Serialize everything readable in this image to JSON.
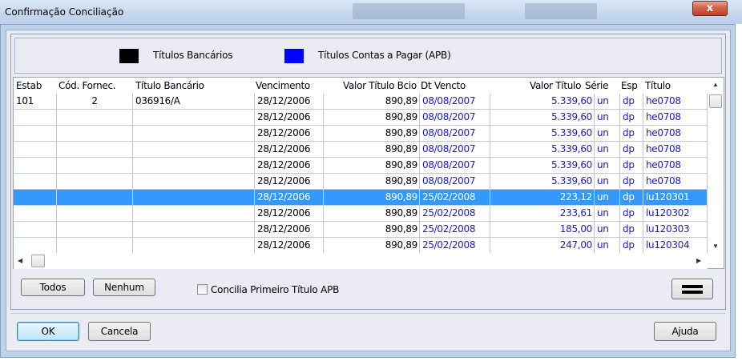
{
  "window": {
    "title": "Confirmação Conciliação",
    "close_glyph": "x"
  },
  "legend": {
    "bank_label": "Títulos Bancários",
    "bank_color": "#000000",
    "apb_label": "Títulos Contas a Pagar (APB)",
    "apb_color": "#0000ff"
  },
  "grid": {
    "columns": [
      "Estab",
      "Cód. Fornec.",
      "Título Bancário",
      "Vencimento",
      "Valor Título Bcio",
      "Dt Vencto",
      "Valor Título",
      "Série",
      "Esp",
      "Título"
    ],
    "rows": [
      {
        "estab": "101",
        "fornec": "2",
        "titulo_bancario": "036916/A",
        "vencimento": "28/12/2006",
        "valor_bcio": "890,89",
        "dt_vencto": "08/08/2007",
        "valor_titulo": "5.339,60",
        "serie": "un",
        "esp": "dp",
        "titulo": "he0708"
      },
      {
        "estab": "",
        "fornec": "",
        "titulo_bancario": "",
        "vencimento": "28/12/2006",
        "valor_bcio": "890,89",
        "dt_vencto": "08/08/2007",
        "valor_titulo": "5.339,60",
        "serie": "un",
        "esp": "dp",
        "titulo": "he0708"
      },
      {
        "estab": "",
        "fornec": "",
        "titulo_bancario": "",
        "vencimento": "28/12/2006",
        "valor_bcio": "890,89",
        "dt_vencto": "08/08/2007",
        "valor_titulo": "5.339,60",
        "serie": "un",
        "esp": "dp",
        "titulo": "he0708"
      },
      {
        "estab": "",
        "fornec": "",
        "titulo_bancario": "",
        "vencimento": "28/12/2006",
        "valor_bcio": "890,89",
        "dt_vencto": "08/08/2007",
        "valor_titulo": "5.339,60",
        "serie": "un",
        "esp": "dp",
        "titulo": "he0708"
      },
      {
        "estab": "",
        "fornec": "",
        "titulo_bancario": "",
        "vencimento": "28/12/2006",
        "valor_bcio": "890,89",
        "dt_vencto": "08/08/2007",
        "valor_titulo": "5.339,60",
        "serie": "un",
        "esp": "dp",
        "titulo": "he0708"
      },
      {
        "estab": "",
        "fornec": "",
        "titulo_bancario": "",
        "vencimento": "28/12/2006",
        "valor_bcio": "890,89",
        "dt_vencto": "08/08/2007",
        "valor_titulo": "5.339,60",
        "serie": "un",
        "esp": "dp",
        "titulo": "he0708"
      },
      {
        "estab": "",
        "fornec": "",
        "titulo_bancario": "",
        "vencimento": "28/12/2006",
        "valor_bcio": "890,89",
        "dt_vencto": "25/02/2008",
        "valor_titulo": "223,12",
        "serie": "un",
        "esp": "dp",
        "titulo": "lu120301",
        "selected": true
      },
      {
        "estab": "",
        "fornec": "",
        "titulo_bancario": "",
        "vencimento": "28/12/2006",
        "valor_bcio": "890,89",
        "dt_vencto": "25/02/2008",
        "valor_titulo": "233,61",
        "serie": "un",
        "esp": "dp",
        "titulo": "lu120302"
      },
      {
        "estab": "",
        "fornec": "",
        "titulo_bancario": "",
        "vencimento": "28/12/2006",
        "valor_bcio": "890,89",
        "dt_vencto": "25/02/2008",
        "valor_titulo": "185,00",
        "serie": "un",
        "esp": "dp",
        "titulo": "lu120303"
      },
      {
        "estab": "",
        "fornec": "",
        "titulo_bancario": "",
        "vencimento": "28/12/2006",
        "valor_bcio": "890,89",
        "dt_vencto": "25/02/2008",
        "valor_titulo": "247,00",
        "serie": "un",
        "esp": "dp",
        "titulo": "lu120304"
      }
    ],
    "selected_row_color": "#3399ff",
    "apb_text_color": "#1a1ac8"
  },
  "scroll": {
    "up_glyph": "▲",
    "down_glyph": "▼",
    "left_glyph": "◀",
    "right_glyph": "▶"
  },
  "actions": {
    "todos_label": "Todos",
    "nenhum_label": "Nenhum",
    "concilia_label": "Concilia Primeiro Título APB",
    "concilia_checked": false
  },
  "footer": {
    "ok_label": "OK",
    "cancela_label": "Cancela",
    "ajuda_label": "Ajuda"
  }
}
